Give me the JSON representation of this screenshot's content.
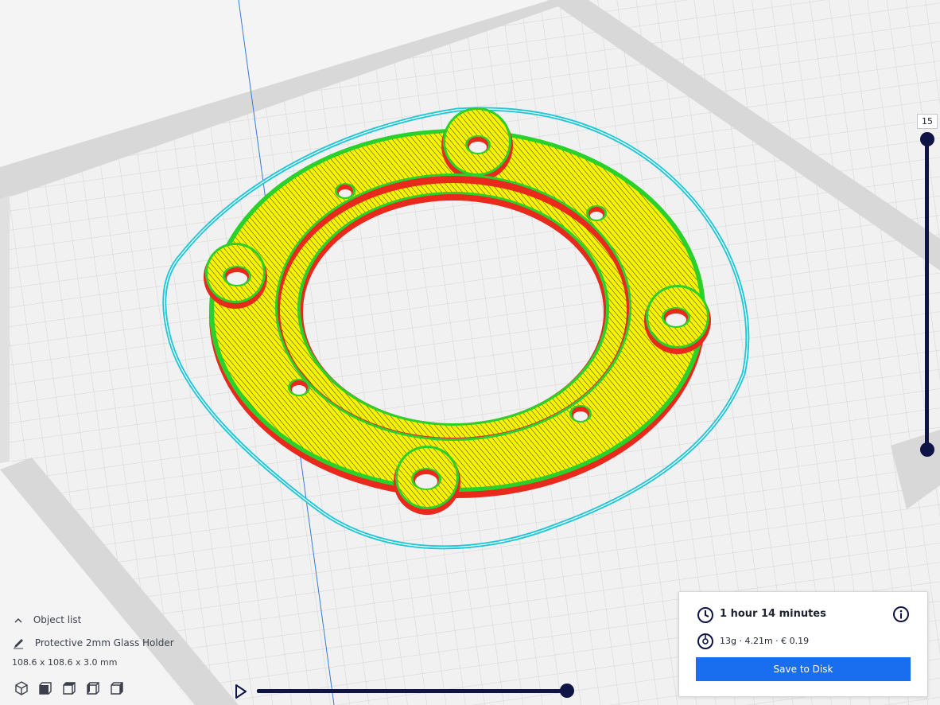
{
  "layer_slider": {
    "current_layer": "15"
  },
  "object_panel": {
    "list_label": "Object list",
    "object_name": "Protective 2mm Glass Holder",
    "dimensions": "108.6 x 108.6 x 3.0 mm",
    "view_buttons": [
      "3d-view-icon",
      "front-view-icon",
      "top-view-icon",
      "left-view-icon",
      "right-view-icon"
    ]
  },
  "print_info": {
    "time": "1 hour 14 minutes",
    "stats": "13g · 4.21m · € 0.19",
    "save_label": "Save to Disk"
  },
  "timeline": {
    "progress": 1.0
  },
  "colors": {
    "accent": "#196ef0",
    "slider": "#0f1446",
    "wall_outer": "#e8291c",
    "wall_inner": "#2bd12b",
    "infill": "#f6f200",
    "skirt": "#22c7d6",
    "build_plate": "#efefef"
  }
}
